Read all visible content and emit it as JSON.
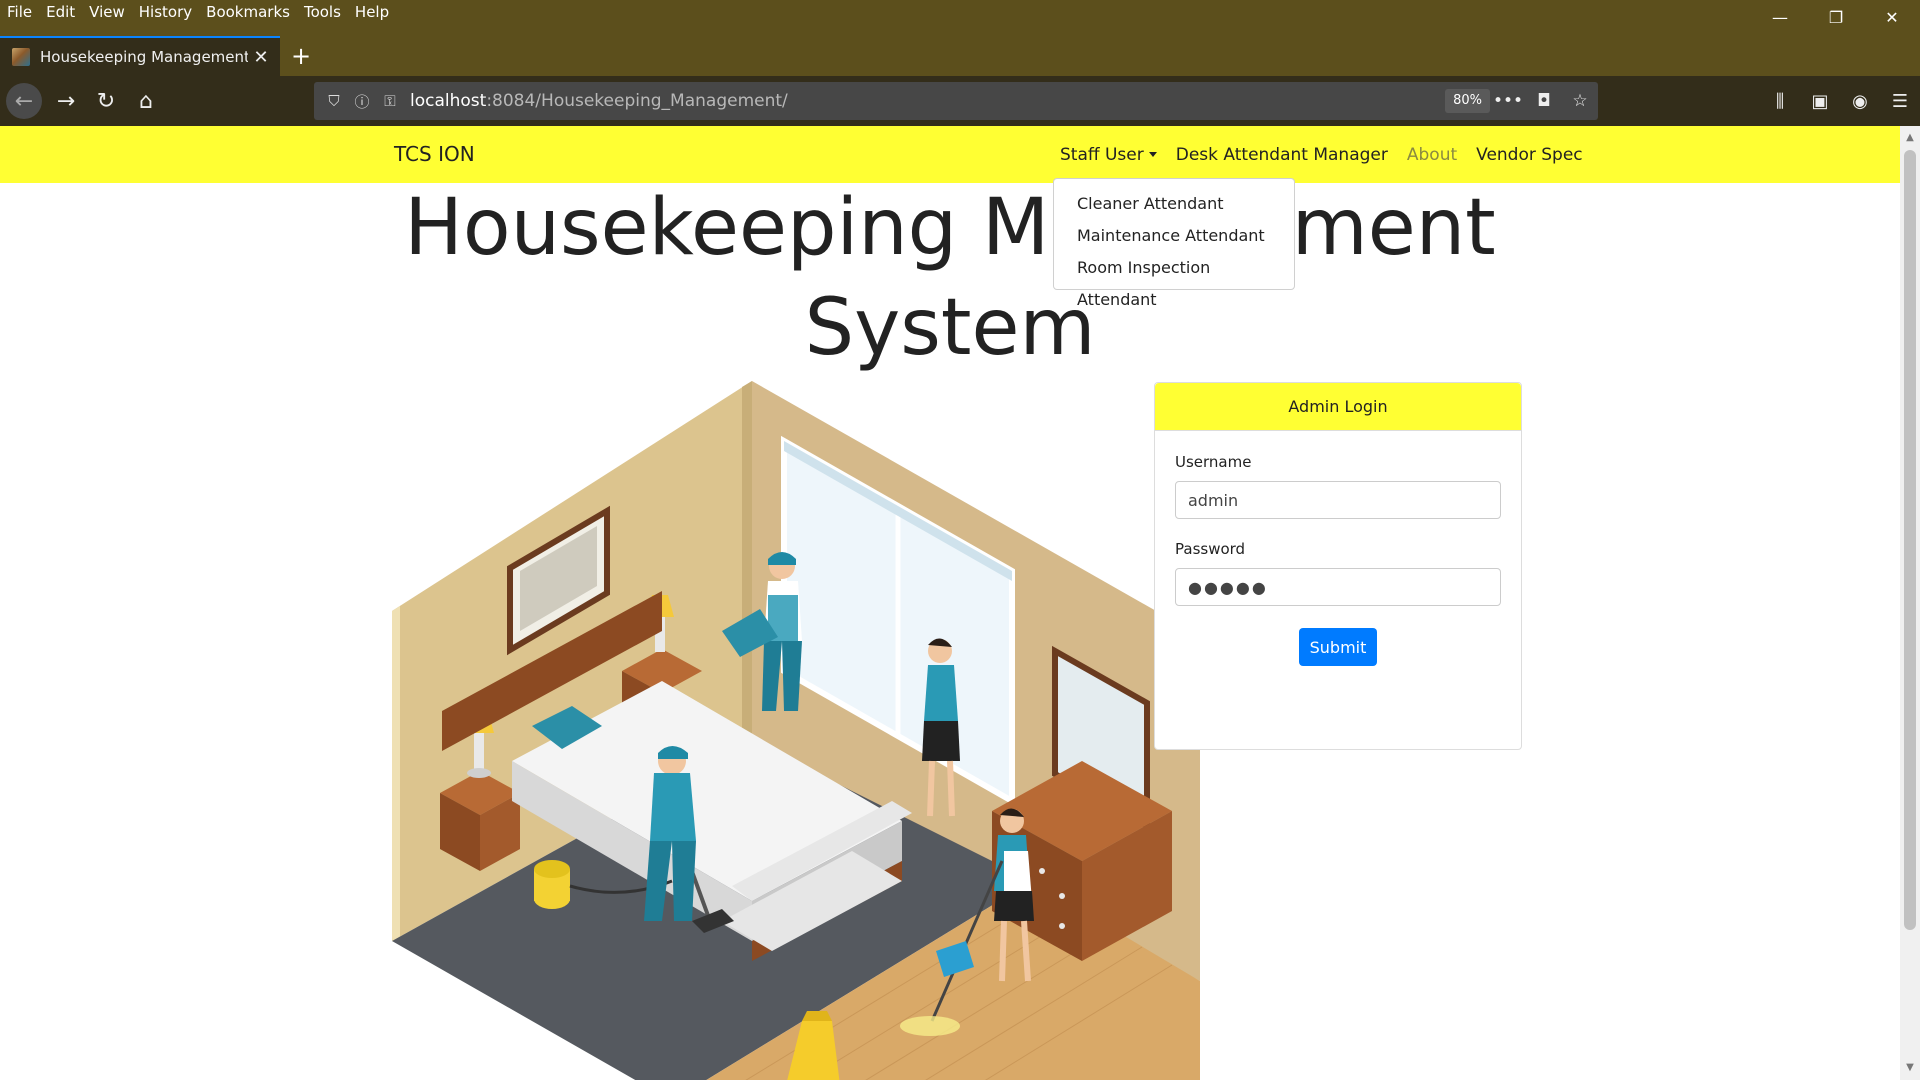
{
  "browser": {
    "menu": [
      "File",
      "Edit",
      "View",
      "History",
      "Bookmarks",
      "Tools",
      "Help"
    ],
    "tab_title": "Housekeeping Management Sy",
    "url_host": "localhost",
    "url_path": ":8084/Housekeeping_Management/",
    "zoom": "80%"
  },
  "site": {
    "brand": "TCS ION",
    "nav": {
      "staff_user": "Staff User",
      "desk_attendant_manager": "Desk Attendant Manager",
      "about": "About",
      "vendor_spec": "Vendor Spec"
    },
    "staff_dropdown": [
      "Cleaner Attendant",
      "Maintenance Attendant",
      "Room Inspection Attendant"
    ],
    "title_line1": "Housekeeping Management",
    "title_line2": "System"
  },
  "login": {
    "header": "Admin Login",
    "username_label": "Username",
    "username_value": "admin",
    "password_label": "Password",
    "password_value": "●●●●●",
    "submit_label": "Submit"
  },
  "colors": {
    "nav_bg": "#ffff33",
    "chrome_bg": "#5c4f1c",
    "submit_bg": "#007bff"
  }
}
